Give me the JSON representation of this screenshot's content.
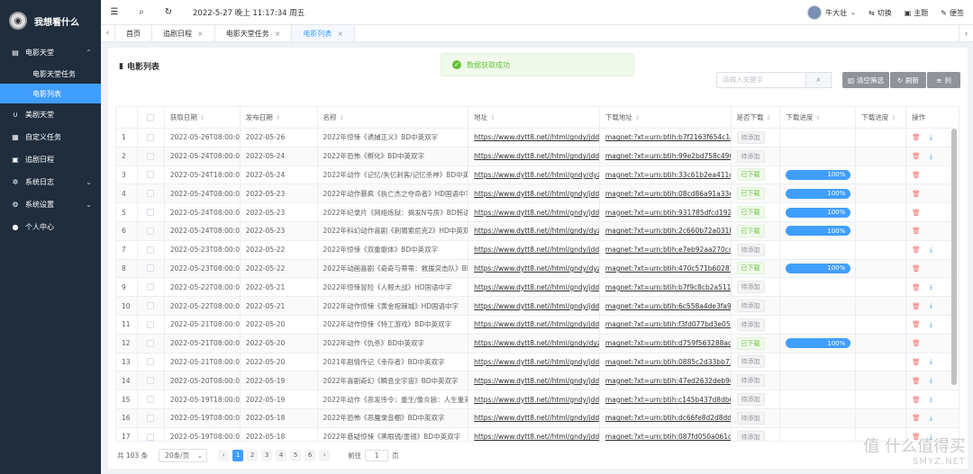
{
  "app": {
    "name": "我想看什么"
  },
  "colors": {
    "sidebar": "#1f2d3d",
    "accent": "#409eff",
    "success": "#67c23a"
  },
  "sidebar": {
    "items": [
      {
        "label": "电影天堂",
        "icon": "film-icon",
        "expanded": true,
        "children": [
          {
            "label": "电影天堂任务"
          },
          {
            "label": "电影列表",
            "active": true
          }
        ]
      },
      {
        "label": "美剧天堂",
        "icon": "magnet-icon"
      },
      {
        "label": "自定义任务",
        "icon": "calendar-icon"
      },
      {
        "label": "追剧日程",
        "icon": "schedule-icon"
      },
      {
        "label": "系统日志",
        "icon": "gear-icon",
        "collapsible": true
      },
      {
        "label": "系统设置",
        "icon": "settings-icon",
        "collapsible": true
      },
      {
        "label": "个人中心",
        "icon": "user-icon"
      }
    ]
  },
  "header": {
    "datetime": "2022-5-27 晚上 11:17:34 周五",
    "user": "牛大壮",
    "switch_label": "切换",
    "theme_label": "主题",
    "note_label": "便签"
  },
  "tabs": [
    {
      "label": "首页"
    },
    {
      "label": "追剧日程",
      "closable": true
    },
    {
      "label": "电影天堂任务",
      "closable": true
    },
    {
      "label": "电影列表",
      "closable": true,
      "active": true
    }
  ],
  "page": {
    "title": "电影列表",
    "toast": "数据获取成功",
    "search_placeholder": "请输入关键字",
    "buttons": {
      "clear": "清空筛选",
      "refresh": "刷新",
      "columns": "列"
    }
  },
  "table": {
    "headers": [
      "获取日期",
      "发布日期",
      "名称",
      "地址",
      "下载地址",
      "是否下载",
      "下载进度",
      "下载进度",
      "操作"
    ],
    "rows": [
      {
        "idx": "1",
        "get": "2022-05-26T08:00:01",
        "pub": "2022-05-26",
        "name": "2022年惊悚《诱捕正义》BD中英双字",
        "url": "https://www.dytt8.net//html/gndy/jddy...",
        "mag": "magnet:?xt=urn:btih:b7f2163f654c1a58...",
        "flag": "待添加",
        "done": false
      },
      {
        "idx": "2",
        "get": "2022-05-24T08:00:05",
        "pub": "2022-05-24",
        "name": "2022年恐怖《孵化》BD中英双字",
        "url": "https://www.dytt8.net//html/gndy/jddy...",
        "mag": "magnet:?xt=urn:btih:99e2bd758c49633...",
        "flag": "待添加",
        "done": false
      },
      {
        "idx": "3",
        "get": "2022-05-24T18:00:01",
        "pub": "2022-05-24",
        "name": "2022年动作《记忆/失忆刺客/记忆杀神》BD中英...",
        "url": "https://www.dytt8.net//html/gndy/dyzz...",
        "mag": "magnet:?xt=urn:btih:33c61b2ea411d12...",
        "flag": "已下载",
        "done": true,
        "progress": "100%"
      },
      {
        "idx": "4",
        "get": "2022-05-24T08:00:08",
        "pub": "2022-05-23",
        "name": "2022年动作暴疯《执亡杰之夺命者》HD国语中字",
        "url": "https://www.dytt8.net//html/gndy/jddy...",
        "mag": "magnet:?xt=urn:btih:08cd86a91a33eed...",
        "flag": "已下载",
        "done": true,
        "progress": "100%"
      },
      {
        "idx": "5",
        "get": "2022-05-24T08:00:05",
        "pub": "2022-05-23",
        "name": "2022年纪录片《网络炼狱：揭发N号房》BD韩语...",
        "url": "https://www.dytt8.net//html/gndy/jddy...",
        "mag": "magnet:?xt=urn:btih:931785dfcd1926d...",
        "flag": "已下载",
        "done": true,
        "progress": "100%"
      },
      {
        "idx": "6",
        "get": "2022-05-24T08:00:01",
        "pub": "2022-05-23",
        "name": "2022年科幻动作喜剧《刺猬索尼克2》HD中英双字",
        "url": "https://www.dytt8.net//html/gndy/dyzz...",
        "mag": "magnet:?xt=urn:btih:2c660b72a031b64...",
        "flag": "已下载",
        "done": true,
        "progress": "100%"
      },
      {
        "idx": "7",
        "get": "2022-05-23T08:00:05",
        "pub": "2022-05-22",
        "name": "2022年惊悚《双重躯体》BD中英双字",
        "url": "https://www.dytt8.net//html/gndy/jddy...",
        "mag": "magnet:?xt=urn:btih:e7eb92aa270cd30...",
        "flag": "待添加",
        "done": false
      },
      {
        "idx": "8",
        "get": "2022-05-23T08:00:01",
        "pub": "2022-05-22",
        "name": "2022年动画喜剧《奇奇与蒂蒂：救援突击队》BD...",
        "url": "https://www.dytt8.net//html/gndy/dyzz...",
        "mag": "magnet:?xt=urn:btih:470c571b60287b7...",
        "flag": "已下载",
        "done": true,
        "progress": "100%"
      },
      {
        "idx": "9",
        "get": "2022-05-22T08:00:06",
        "pub": "2022-05-21",
        "name": "2022年惊悚冒险《人鲸大战》HD国语中字",
        "url": "https://www.dytt8.net//html/gndy/jddy...",
        "mag": "magnet:?xt=urn:btih:b7f9c8cb2a51117...",
        "flag": "待添加",
        "done": false
      },
      {
        "idx": "10",
        "get": "2022-05-22T08:00:02",
        "pub": "2022-05-21",
        "name": "2022年动作惊悚《黄金棺棘城》HD国语中字",
        "url": "https://www.dytt8.net//html/gndy/jddy...",
        "mag": "magnet:?xt=urn:btih:6c558a4de3fa9c9d...",
        "flag": "待添加",
        "done": false
      },
      {
        "idx": "11",
        "get": "2022-05-21T08:00:08",
        "pub": "2022-05-20",
        "name": "2022年动作惊悚《特工游戏》BD中英双字",
        "url": "https://www.dytt8.net//html/gndy/jddy...",
        "mag": "magnet:?xt=urn:btih:f3fd077bd3e0534...",
        "flag": "待添加",
        "done": false
      },
      {
        "idx": "12",
        "get": "2022-05-21T08:00:05",
        "pub": "2022-05-20",
        "name": "2022年动作《仇杀》BD中英双字",
        "url": "https://www.dytt8.net//html/gndy/dyzz...",
        "mag": "magnet:?xt=urn:btih:d759f563288add1...",
        "flag": "已下载",
        "done": true,
        "progress": "100%"
      },
      {
        "idx": "13",
        "get": "2022-05-21T08:00:01",
        "pub": "2022-05-20",
        "name": "2021年剧情传记《幸存者》BD中英双字",
        "url": "https://www.dytt8.net//html/gndy/jddy...",
        "mag": "magnet:?xt=urn:btih:0885c2d33bb7399...",
        "flag": "待添加",
        "done": false
      },
      {
        "idx": "14",
        "get": "2022-05-20T08:00:02",
        "pub": "2022-05-19",
        "name": "2022年喜剧奇幻《瞬息全宇宙》BD中英双字",
        "url": "https://www.dytt8.net//html/gndy/jddy...",
        "mag": "magnet:?xt=urn:btih:47ed2632deb96b4...",
        "flag": "待添加",
        "done": false
      },
      {
        "idx": "15",
        "get": "2022-05-19T18:00:09",
        "pub": "2022-05-19",
        "name": "2022年动作《恶发传令：重生/像炎狼：人生重来...",
        "url": "https://www.dytt8.net//html/gndy/jddy...",
        "mag": "magnet:?xt=urn:btih:c145b437d8db6e7...",
        "flag": "待添加",
        "done": false
      },
      {
        "idx": "16",
        "get": "2022-05-19T08:00:06",
        "pub": "2022-05-18",
        "name": "2022年恐怖《恶魔录音棚》BD中英双字",
        "url": "https://www.dytt8.net//html/gndy/jddy...",
        "mag": "magnet:?xt=urn:btih:dc66fe8d2d8dd31...",
        "flag": "待添加",
        "done": false
      },
      {
        "idx": "17",
        "get": "2022-05-19T08:00:02",
        "pub": "2022-05-18",
        "name": "2022年悬疑惊悚《黑眼镜/墨镜》BD中英双字",
        "url": "https://www.dytt8.net//html/gndy/jddy...",
        "mag": "magnet:?xt=urn:btih:087fd050a061d3a...",
        "flag": "待添加",
        "done": false
      }
    ]
  },
  "pagination": {
    "total": "共 103 条",
    "page_size": "20条/页",
    "pages": [
      "1",
      "2",
      "3",
      "4",
      "5",
      "6"
    ],
    "current": "1",
    "goto_label": "前往",
    "goto_value": "1",
    "goto_suffix": "页"
  },
  "watermark": {
    "text": "值 什么值得买",
    "sub": "SMYZ.NET"
  }
}
